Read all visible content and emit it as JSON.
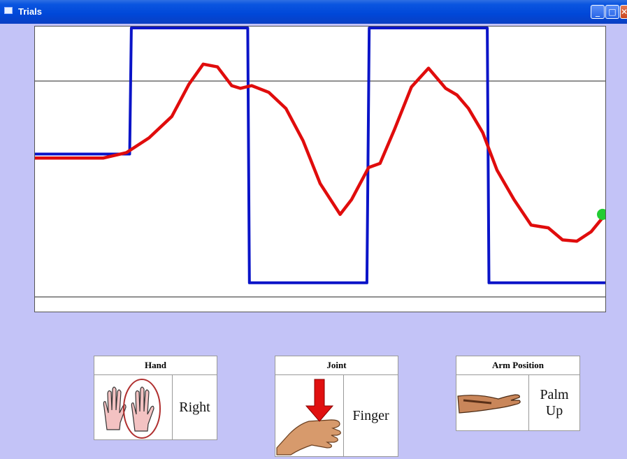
{
  "window": {
    "title": "Trials"
  },
  "titlebar_buttons": {
    "minimize": "_",
    "maximize": "□",
    "close": "✕"
  },
  "panels": {
    "hand": {
      "header": "Hand",
      "value": "Right"
    },
    "joint": {
      "header": "Joint",
      "value": "Finger"
    },
    "arm": {
      "header": "Arm Position",
      "value_line1": "Palm",
      "value_line2": "Up"
    }
  },
  "colors": {
    "target": "#0a14c8",
    "trace": "#e00c0c",
    "cursor_dot": "#22cc33",
    "background": "#c3c3f7"
  },
  "chart_data": {
    "type": "line",
    "grid": false,
    "xlim": [
      0,
      100
    ],
    "ylim": [
      0,
      100
    ],
    "series": [
      {
        "role": "target",
        "x": [
          0,
          16.6,
          16.9,
          37.3,
          37.6,
          58.2,
          58.6,
          79.3,
          79.6,
          100
        ],
        "y": [
          53,
          53,
          100,
          100,
          5,
          5,
          100,
          100,
          5,
          5
        ]
      },
      {
        "role": "trace",
        "x": [
          0,
          6,
          12,
          16,
          20,
          24,
          27,
          29.5,
          32,
          34.5,
          36,
          38,
          41,
          44,
          47,
          50,
          53.5,
          55.5,
          58.5,
          60.5,
          63,
          66,
          69,
          72,
          74,
          76,
          78.5,
          81,
          84,
          87,
          90,
          92.5,
          95,
          97.5,
          100
        ],
        "y": [
          51.5,
          51.5,
          51.5,
          53.5,
          59,
          67,
          79,
          86.5,
          85.5,
          78.5,
          77.5,
          78.5,
          76,
          70,
          58,
          42,
          30.5,
          36,
          48,
          49.5,
          62,
          78,
          85,
          77.5,
          75,
          70,
          61,
          47,
          36,
          26.5,
          25.5,
          21,
          20.5,
          24,
          30.5
        ]
      }
    ],
    "cursor": {
      "x": 100,
      "y": 30.5
    }
  }
}
